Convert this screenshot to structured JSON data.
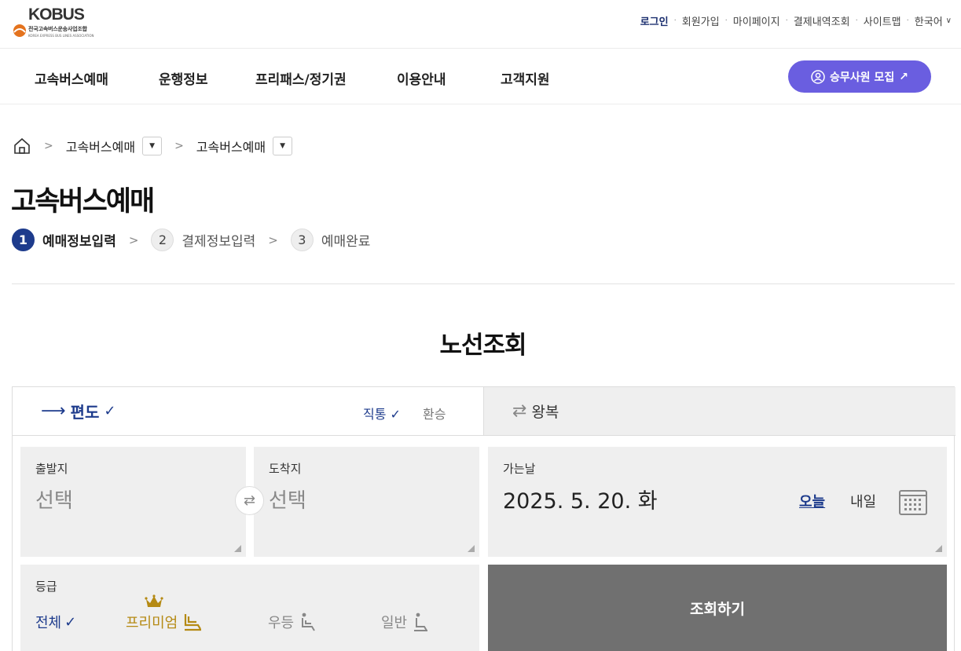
{
  "logo": {
    "word": "KOBUS",
    "sub": "전국고속버스운송사업조합",
    "sub_en": "KOREA EXPRESS BUS LINES ASSOCIATION"
  },
  "utility": {
    "login": "로그인",
    "signup": "회원가입",
    "mypage": "마이페이지",
    "payment_history": "결제내역조회",
    "sitemap": "사이트맵",
    "language": "한국어"
  },
  "nav": {
    "items": [
      "고속버스예매",
      "운행정보",
      "프리패스/정기권",
      "이용안내",
      "고객지원"
    ],
    "recruit_button": "승무사원 모집"
  },
  "breadcrumb": {
    "level1": "고속버스예매",
    "level2": "고속버스예매"
  },
  "page_title": "고속버스예매",
  "steps": [
    {
      "num": "1",
      "label": "예매정보입력",
      "active": true
    },
    {
      "num": "2",
      "label": "결제정보입력",
      "active": false
    },
    {
      "num": "3",
      "label": "예매완료",
      "active": false
    }
  ],
  "section_title": "노선조회",
  "trip": {
    "one_way": "편도",
    "direct": "직통",
    "transfer": "환승",
    "round_trip": "왕복"
  },
  "departure": {
    "label": "출발지",
    "value": "선택"
  },
  "arrival": {
    "label": "도착지",
    "value": "선택"
  },
  "date": {
    "label": "가는날",
    "value": "2025. 5. 20. 화",
    "today": "오늘",
    "tomorrow": "내일"
  },
  "grade": {
    "label": "등급",
    "all": "전체",
    "premium": "프리미엄",
    "excellent": "우등",
    "normal": "일반"
  },
  "search_button": "조회하기",
  "colors": {
    "primary": "#1d3b8c",
    "recruit": "#6a5ee0",
    "premium": "#b58a14",
    "button_gray": "#707070"
  }
}
